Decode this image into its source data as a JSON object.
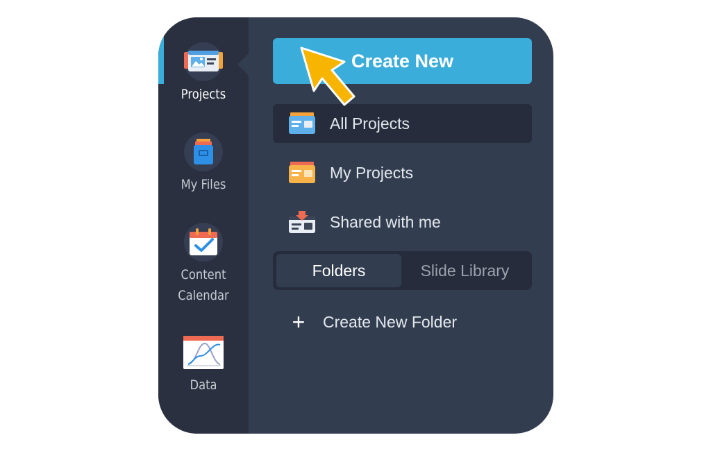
{
  "sidebar": {
    "items": [
      {
        "label": "Projects",
        "icon": "projects-icon",
        "active": true
      },
      {
        "label": "My Files",
        "icon": "files-icon",
        "active": false
      },
      {
        "label": "Content\nCalendar",
        "icon": "calendar-icon",
        "active": false
      },
      {
        "label": "Data",
        "icon": "data-chart-icon",
        "active": false
      }
    ]
  },
  "main": {
    "create_button": "Create New",
    "project_filters": [
      {
        "label": "All Projects",
        "icon": "all-projects-icon",
        "active": true
      },
      {
        "label": "My Projects",
        "icon": "my-projects-icon",
        "active": false
      },
      {
        "label": "Shared with me",
        "icon": "shared-icon",
        "active": false
      }
    ],
    "tabs": [
      {
        "label": "Folders",
        "active": true
      },
      {
        "label": "Slide Library",
        "active": false
      }
    ],
    "create_folder": "Create New Folder"
  },
  "colors": {
    "accent": "#3badda",
    "rail": "#2a303f",
    "panel": "#323e4f",
    "pointer": "#f7b400"
  }
}
